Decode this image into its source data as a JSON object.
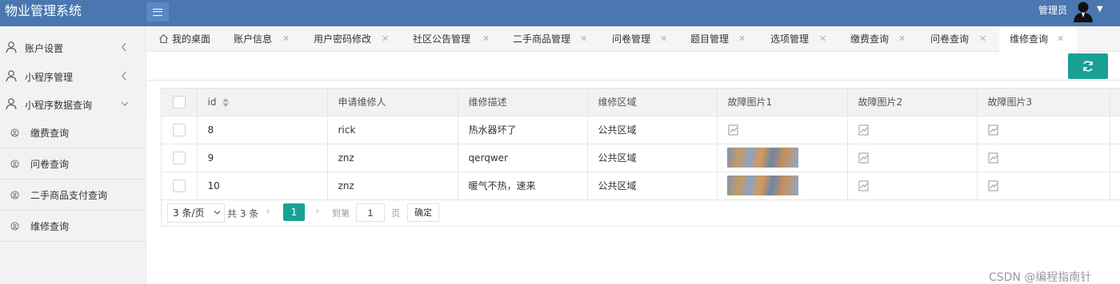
{
  "header": {
    "app_title": "物业管理系统",
    "user_name": "管理员"
  },
  "sidebar": {
    "groups": [
      {
        "label": "账户设置"
      },
      {
        "label": "小程序管理"
      },
      {
        "label": "小程序数据查询"
      }
    ],
    "sub_items": [
      {
        "label": "缴费查询"
      },
      {
        "label": "问卷查询"
      },
      {
        "label": "二手商品支付查询"
      },
      {
        "label": "维修查询"
      }
    ]
  },
  "tabs": [
    {
      "label": "我的桌面"
    },
    {
      "label": "账户信息"
    },
    {
      "label": "用户密码修改"
    },
    {
      "label": "社区公告管理"
    },
    {
      "label": "二手商品管理"
    },
    {
      "label": "问卷管理"
    },
    {
      "label": "题目管理"
    },
    {
      "label": "选项管理"
    },
    {
      "label": "缴费查询"
    },
    {
      "label": "问卷查询"
    },
    {
      "label": "维修查询"
    }
  ],
  "table": {
    "columns": [
      "id",
      "申请维修人",
      "维修描述",
      "维修区域",
      "故障图片1",
      "故障图片2",
      "故障图片3"
    ],
    "rows": [
      {
        "id": "8",
        "applicant": "rick",
        "description": "热水器坏了",
        "area": "公共区域"
      },
      {
        "id": "9",
        "applicant": "znz",
        "description": "qerqwer",
        "area": "公共区域"
      },
      {
        "id": "10",
        "applicant": "znz",
        "description": "暖气不热，速来",
        "area": "公共区域"
      }
    ]
  },
  "pager": {
    "page_size": "3 条/页",
    "total": "共 3 条",
    "current_page": "1",
    "goto_label": "到第",
    "goto_value": "1",
    "page_unit": "页",
    "confirm_label": "确定"
  },
  "colors": {
    "header_bg": "#4a77b0",
    "accent": "#1aa094"
  },
  "watermark": "CSDN @编程指南针"
}
